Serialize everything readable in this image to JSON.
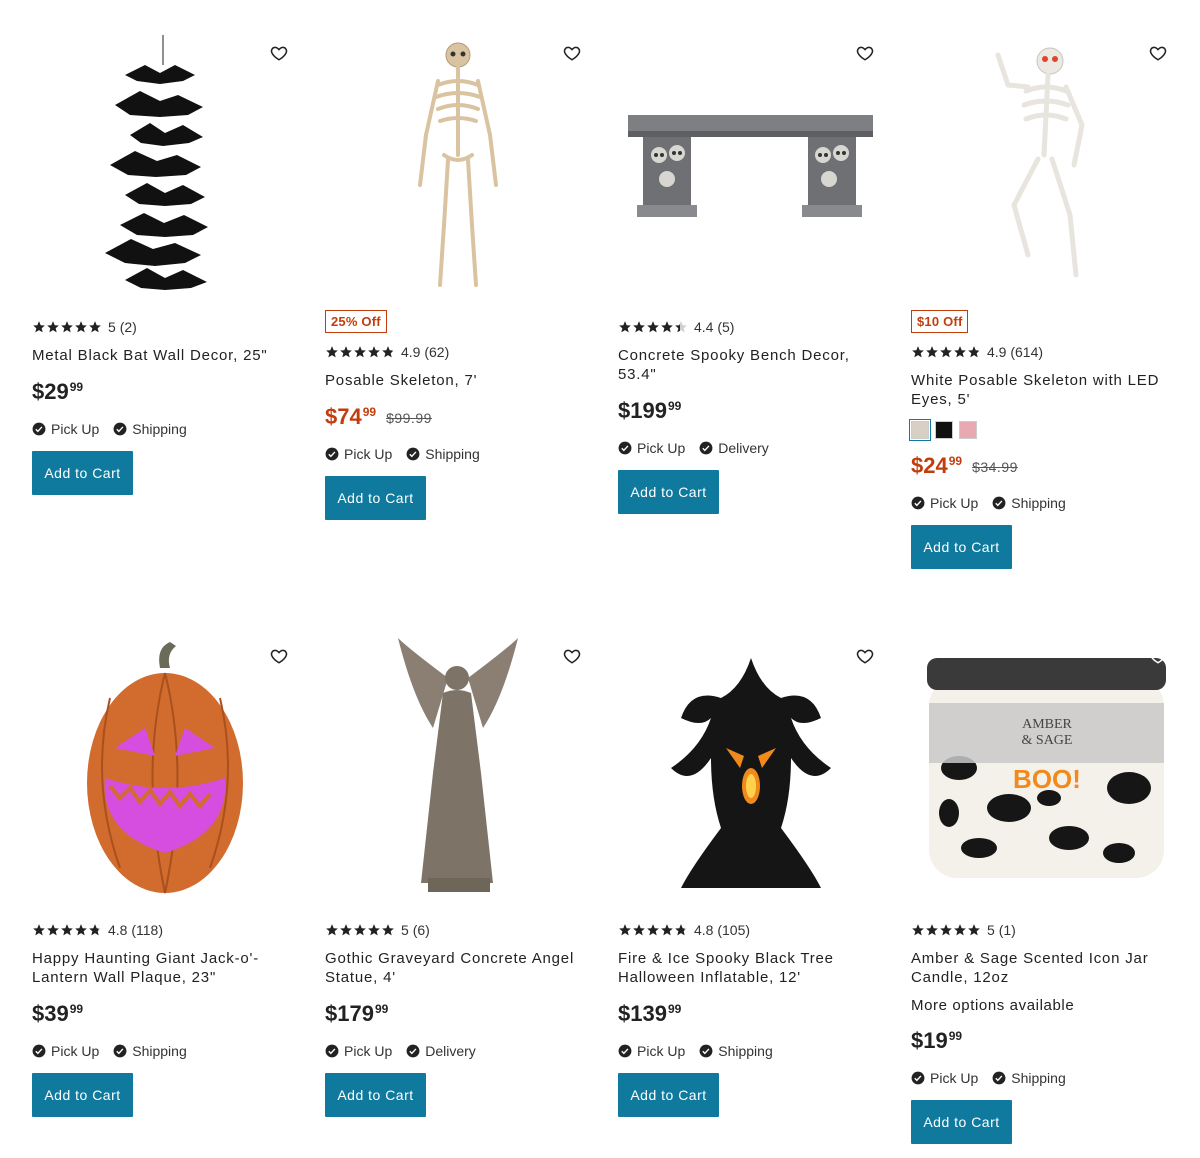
{
  "colors": {
    "accent": "#0f7a9e",
    "sale": "#c23d0b"
  },
  "products": [
    {
      "title": "Metal Black Bat Wall Decor, 25\"",
      "rating": "5",
      "count": "(2)",
      "badge": "",
      "price_dollars": "$29",
      "price_cents": "99",
      "orig_price": "",
      "fulfill": [
        "Pick Up",
        "Shipping"
      ],
      "button": "Add to Cart",
      "more": "",
      "image": "bat-wall-decor",
      "stars_value": 5
    },
    {
      "title": "Posable Skeleton, 7'",
      "rating": "4.9",
      "count": "(62)",
      "badge": "25% Off",
      "price_dollars": "$74",
      "price_cents": "99",
      "orig_price": "$99.99",
      "fulfill": [
        "Pick Up",
        "Shipping"
      ],
      "button": "Add to Cart",
      "more": "",
      "image": "skeleton",
      "stars_value": 4.9
    },
    {
      "title": "Concrete Spooky Bench Decor, 53.4\"",
      "rating": "4.4",
      "count": "(5)",
      "badge": "",
      "price_dollars": "$199",
      "price_cents": "99",
      "orig_price": "",
      "fulfill": [
        "Pick Up",
        "Delivery"
      ],
      "button": "Add to Cart",
      "more": "",
      "image": "skull-bench",
      "stars_value": 4.4
    },
    {
      "title": "White Posable Skeleton with LED Eyes, 5'",
      "rating": "4.9",
      "count": "(614)",
      "badge": "$10 Off",
      "price_dollars": "$24",
      "price_cents": "99",
      "orig_price": "$34.99",
      "fulfill": [
        "Pick Up",
        "Shipping"
      ],
      "button": "Add to Cart",
      "more": "",
      "image": "led-skeleton",
      "stars_value": 4.9,
      "swatches": [
        "#d8d0c4",
        "#111111",
        "#e9a9b3"
      ]
    },
    {
      "title": "Happy Haunting Giant Jack-o'-Lantern Wall Plaque, 23\"",
      "rating": "4.8",
      "count": "(118)",
      "badge": "",
      "price_dollars": "$39",
      "price_cents": "99",
      "orig_price": "",
      "fulfill": [
        "Pick Up",
        "Shipping"
      ],
      "button": "Add to Cart",
      "more": "",
      "image": "jack-o-lantern",
      "stars_value": 4.8
    },
    {
      "title": "Gothic Graveyard Concrete Angel Statue, 4'",
      "rating": "5",
      "count": "(6)",
      "badge": "",
      "price_dollars": "$179",
      "price_cents": "99",
      "orig_price": "",
      "fulfill": [
        "Pick Up",
        "Delivery"
      ],
      "button": "Add to Cart",
      "more": "",
      "image": "angel-statue",
      "stars_value": 5
    },
    {
      "title": "Fire & Ice Spooky Black Tree Halloween Inflatable, 12'",
      "rating": "4.8",
      "count": "(105)",
      "badge": "",
      "price_dollars": "$139",
      "price_cents": "99",
      "orig_price": "",
      "fulfill": [
        "Pick Up",
        "Shipping"
      ],
      "button": "Add to Cart",
      "more": "",
      "image": "spooky-tree-inflatable",
      "stars_value": 4.8
    },
    {
      "title": "Amber & Sage Scented Icon Jar Candle, 12oz",
      "rating": "5",
      "count": "(1)",
      "badge": "",
      "price_dollars": "$19",
      "price_cents": "99",
      "orig_price": "",
      "fulfill": [
        "Pick Up",
        "Shipping"
      ],
      "button": "Add to Cart",
      "more": "More options available",
      "image": "jar-candle",
      "stars_value": 5,
      "candle_label": [
        "AMBER",
        "& SAGE"
      ],
      "candle_text": "BOO!"
    }
  ]
}
